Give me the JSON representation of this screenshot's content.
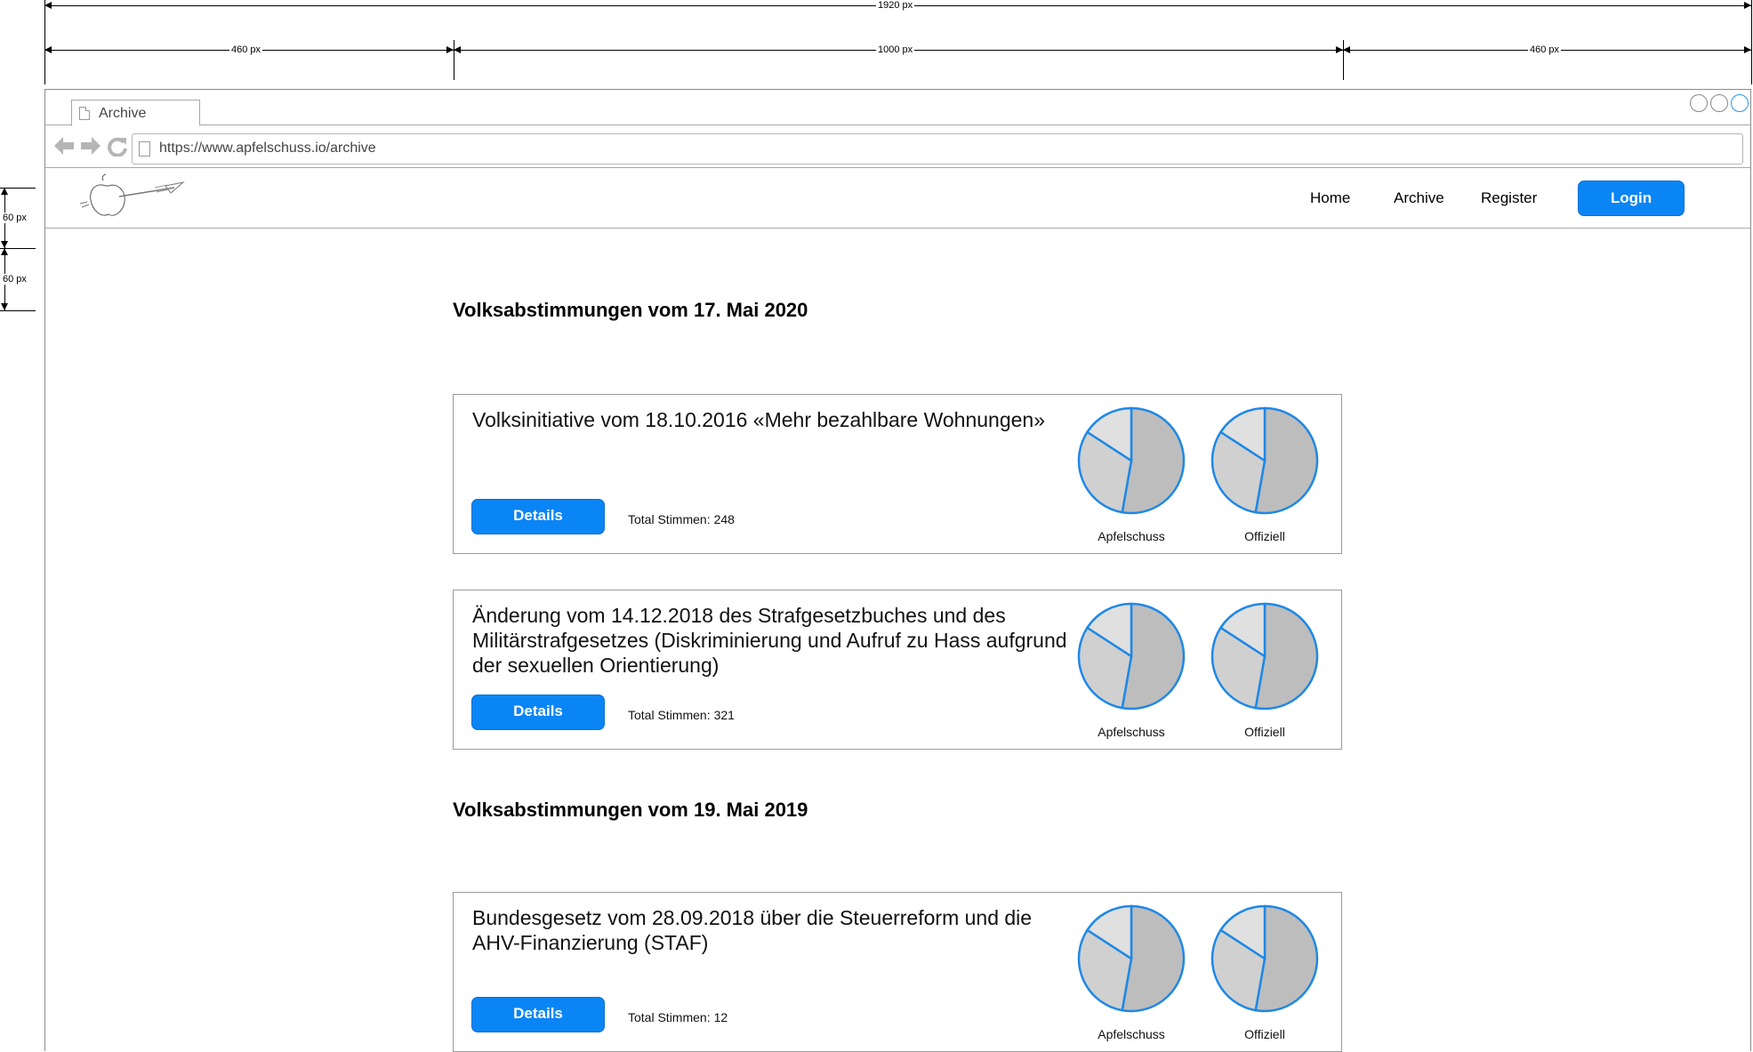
{
  "annotations": {
    "total_width": "1920 px",
    "left_margin": "460 px",
    "content_width": "1000 px",
    "right_margin": "460 px",
    "navbar_height": "60 px",
    "gap_height": "60 px"
  },
  "browser": {
    "tab_title": "Archive",
    "url": "https://www.apfelschuss.io/archive"
  },
  "navbar": {
    "links": [
      "Home",
      "Archive",
      "Register"
    ],
    "login_label": "Login"
  },
  "sections": [
    {
      "title": "Volksabstimmungen vom 17. Mai 2020",
      "votes": [
        {
          "title": "Volksinitiative vom 18.10.2016 «Mehr bezahlbare Wohnungen»",
          "details_label": "Details",
          "total_label": "Total Stimmen:",
          "total_value": "248",
          "chart_labels": [
            "Apfelschuss",
            "Offiziell"
          ]
        },
        {
          "title": "Änderung vom 14.12.2018 des Strafgesetzbuches und des Militärstrafgesetzes (Diskriminierung und Aufruf zu Hass aufgrund der sexuellen Orientierung)",
          "details_label": "Details",
          "total_label": "Total Stimmen:",
          "total_value": "321",
          "chart_labels": [
            "Apfelschuss",
            "Offiziell"
          ]
        }
      ]
    },
    {
      "title": "Volksabstimmungen vom 19. Mai 2019",
      "votes": [
        {
          "title": "Bundesgesetz vom 28.09.2018 über die Steuerreform und die AHV-Finanzierung (STAF)",
          "details_label": "Details",
          "total_label": "Total Stimmen:",
          "total_value": "12",
          "chart_labels": [
            "Apfelschuss",
            "Offiziell"
          ]
        }
      ]
    }
  ],
  "colors": {
    "primary_button": "#0a85f5",
    "pie_outline": "#1e88e5",
    "pie_fill_dark": "#bdbdbd",
    "pie_fill_mid": "#d0d0d0",
    "pie_fill_light": "#e0e0e0"
  },
  "icons": {
    "back": "arrow-left-icon",
    "forward": "arrow-right-icon",
    "reload": "reload-icon",
    "page": "document-icon"
  }
}
